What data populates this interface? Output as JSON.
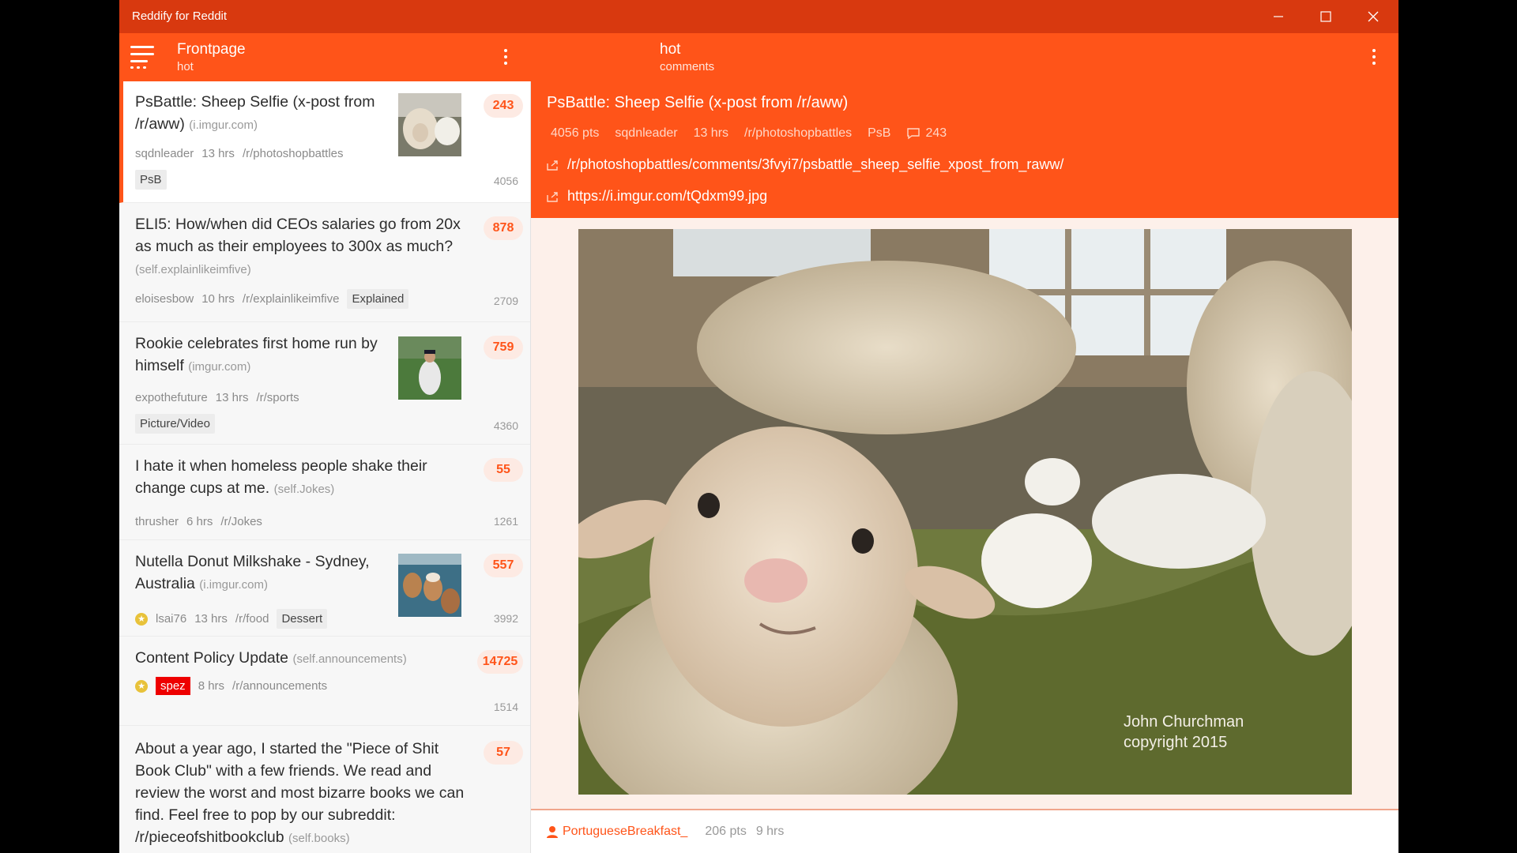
{
  "app": {
    "title": "Reddify for Reddit"
  },
  "colors": {
    "accent": "#ff5419",
    "titlebar": "#d8390f"
  },
  "left_header": {
    "title": "Frontpage",
    "subtitle": "hot"
  },
  "right_header": {
    "title": "hot",
    "subtitle": "comments"
  },
  "posts": [
    {
      "title": "PsBattle: Sheep Selfie (x-post from /r/aww)",
      "domain": "(i.imgur.com)",
      "author": "sqdnleader",
      "age": "13 hrs",
      "subreddit": "/r/photoshopbattles",
      "flair": "PsB",
      "score": "243",
      "comments": "4056",
      "thumb": "sheep"
    },
    {
      "title": "ELI5: How/when did CEOs salaries go from 20x as much as their employees to 300x as much?",
      "domain": "(self.explainlikeimfive)",
      "author": "eloisesbow",
      "age": "10 hrs",
      "subreddit": "/r/explainlikeimfive",
      "flair": "Explained",
      "score": "878",
      "comments": "2709"
    },
    {
      "title": "Rookie celebrates first home run by himself",
      "domain": "(imgur.com)",
      "author": "expothefuture",
      "age": "13 hrs",
      "subreddit": "/r/sports",
      "flair": "Picture/Video",
      "score": "759",
      "comments": "4360",
      "thumb": "baseball"
    },
    {
      "title": "I hate it when homeless people shake their change cups at me.",
      "domain": "(self.Jokes)",
      "author": "thrusher",
      "age": "6 hrs",
      "subreddit": "/r/Jokes",
      "score": "55",
      "comments": "1261"
    },
    {
      "title": "Nutella Donut Milkshake - Sydney, Australia",
      "domain": "(i.imgur.com)",
      "author": "lsai76",
      "age": "13 hrs",
      "subreddit": "/r/food",
      "flair": "Dessert",
      "score": "557",
      "comments": "3992",
      "thumb": "food"
    },
    {
      "title": "Content Policy Update",
      "domain": "(self.announcements)",
      "author": "spez",
      "age": "8 hrs",
      "subreddit": "/r/announcements",
      "score": "14725",
      "comments": "1514"
    },
    {
      "title": "About a year ago, I started the \"Piece of Shit Book Club\" with a few friends. We read and review the worst and most bizarre books we can find. Feel free to pop by our subreddit: /r/pieceofshitbookclub",
      "domain": "(self.books)",
      "score": "57"
    }
  ],
  "detail": {
    "title": "PsBattle: Sheep Selfie (x-post from /r/aww)",
    "points": "4056 pts",
    "author": "sqdnleader",
    "age": "13 hrs",
    "subreddit": "/r/photoshopbattles",
    "flair": "PsB",
    "comments": "243",
    "permalink": "/r/photoshopbattles/comments/3fvyi7/psbattle_sheep_selfie_xpost_from_raww/",
    "url": "https://i.imgur.com/tQdxm99.jpg",
    "watermark_line1": "John Churchman",
    "watermark_line2": "copyright 2015"
  },
  "comment_bar": {
    "author": "PortugueseBreakfast_",
    "points": "206 pts",
    "age": "9 hrs"
  }
}
